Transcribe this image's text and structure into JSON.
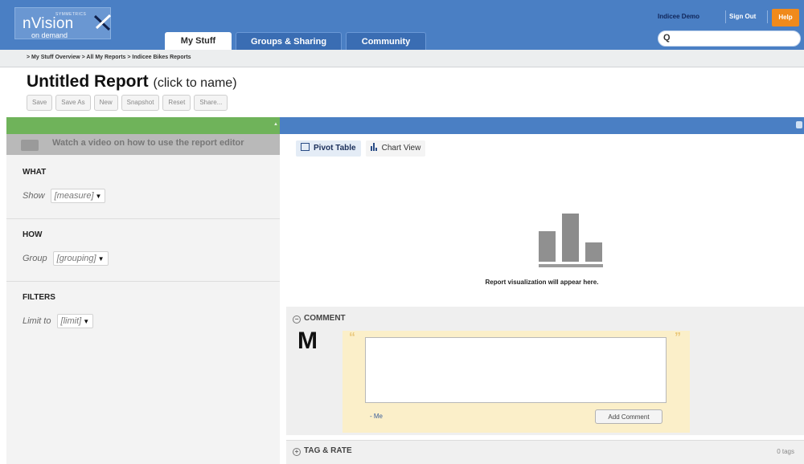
{
  "logo": {
    "top": "SYMMETRICS",
    "name": "nVision",
    "sub": "on demand"
  },
  "tabs": [
    {
      "label": "My Stuff"
    },
    {
      "label": "Groups & Sharing"
    },
    {
      "label": "Community"
    }
  ],
  "user": {
    "name": "Indicee Demo",
    "sign_out": "Sign Out",
    "help": "Help"
  },
  "search": {
    "value": "",
    "placeholder": ""
  },
  "breadcrumb": "> My Stuff Overview > All My Reports > Indicee Bikes Reports",
  "report": {
    "title": "Untitled Report",
    "hint": "(click to name)"
  },
  "buttons": [
    "Save",
    "Save As",
    "New",
    "Snapshot",
    "Reset",
    "Share..."
  ],
  "left": {
    "video": "Watch a video on how to use the report editor",
    "what": {
      "heading": "WHAT",
      "label": "Show",
      "value": "[measure]"
    },
    "how": {
      "heading": "HOW",
      "label": "Group",
      "value": "[grouping]"
    },
    "filters": {
      "heading": "FILTERS",
      "label": "Limit to",
      "value": "[limit]"
    }
  },
  "views": {
    "pivot": "Pivot Table",
    "chart": "Chart View"
  },
  "placeholder_msg": "Report visualization will appear here.",
  "comment": {
    "heading": "COMMENT",
    "avatar": "M",
    "author": "- Me",
    "button": "Add Comment"
  },
  "tag": {
    "heading": "TAG & RATE",
    "count": "0 tags"
  },
  "colors": {
    "header": "#4a7fc4",
    "green_band": "#6fb35a",
    "help": "#f08a1c",
    "comment_bg": "#fbefc9"
  }
}
